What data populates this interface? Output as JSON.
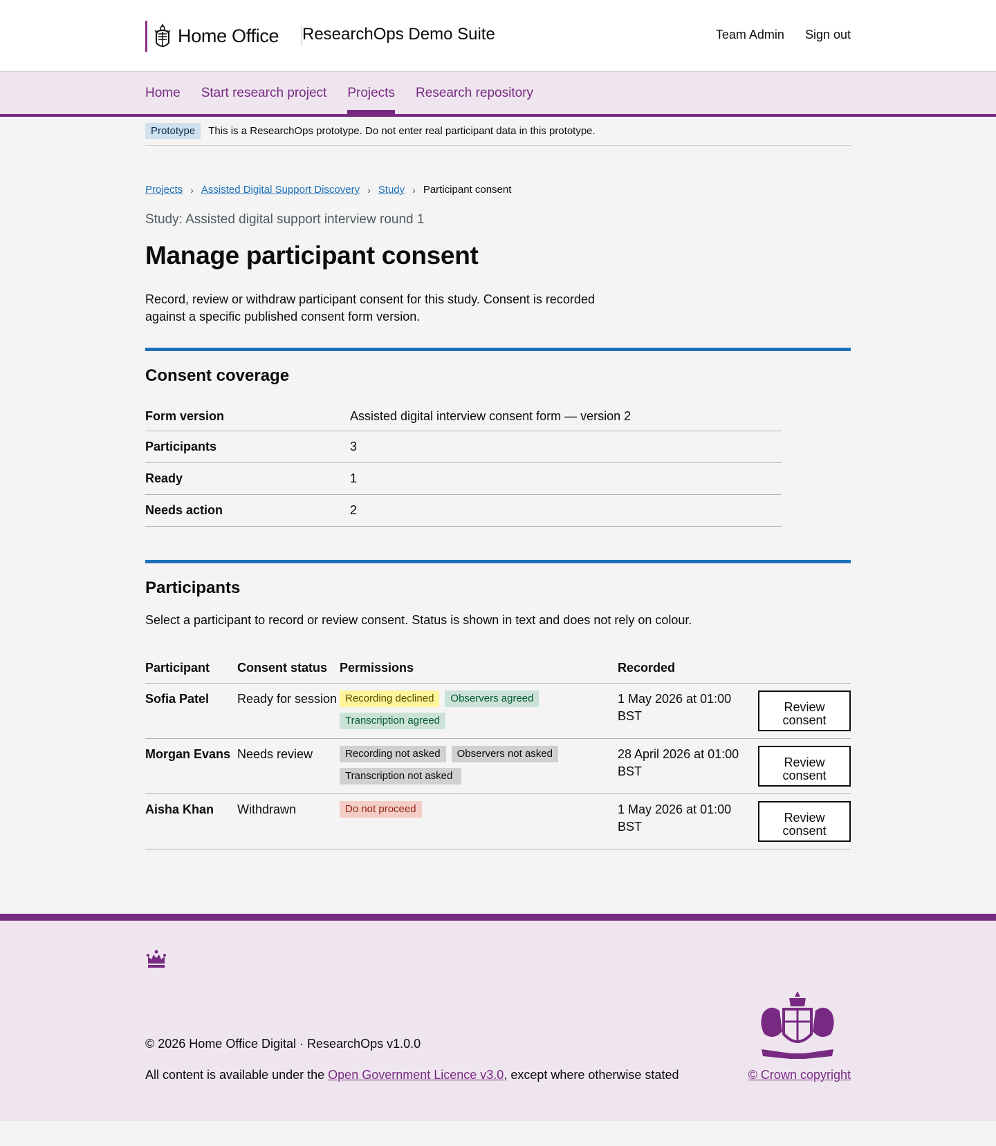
{
  "header": {
    "org_name": "Home Office",
    "service_name": "ResearchOps Demo Suite",
    "links": [
      "Team Admin",
      "Sign out"
    ]
  },
  "nav": {
    "items": [
      "Home",
      "Start research project",
      "Projects",
      "Research repository"
    ],
    "active": "Projects"
  },
  "phase": {
    "tag": "Prototype",
    "text": "This is a ResearchOps prototype. Do not enter real participant data in this prototype."
  },
  "breadcrumbs": {
    "links": [
      "Projects",
      "Assisted Digital Support Discovery",
      "Study"
    ],
    "current": "Participant consent"
  },
  "page": {
    "caption": "Study: Assisted digital support interview round 1",
    "title": "Manage participant consent",
    "lede": "Record, review or withdraw participant consent for this study. Consent is recorded against a specific published consent form version."
  },
  "coverage": {
    "heading": "Consent coverage",
    "rows": [
      {
        "key": "Form version",
        "value": "Assisted digital interview consent form — version 2"
      },
      {
        "key": "Participants",
        "value": "3"
      },
      {
        "key": "Ready",
        "value": "1"
      },
      {
        "key": "Needs action",
        "value": "2"
      }
    ]
  },
  "participants": {
    "heading": "Participants",
    "hint": "Select a participant to record or review consent. Status is shown in text and does not rely on colour.",
    "columns": [
      "Participant",
      "Consent status",
      "Permissions",
      "Recorded",
      ""
    ],
    "rows": [
      {
        "name": "Sofia Patel",
        "status": "Ready for session",
        "tags": [
          {
            "label": "Recording declined",
            "color": "#fff59a"
          },
          {
            "label": "Observers agreed",
            "color": "#cce2d8"
          },
          {
            "label": "Transcription agreed",
            "color": "#cce2d8"
          }
        ],
        "recorded": "1 May 2026 at 01:00 BST",
        "action": "Review consent"
      },
      {
        "name": "Morgan Evans",
        "status": "Needs review",
        "tags": [
          {
            "label": "Recording not asked",
            "color": "#d0d0d0"
          },
          {
            "label": "Observers not asked",
            "color": "#d0d0d0"
          },
          {
            "label": "Transcription not asked",
            "color": "#d0d0d0"
          }
        ],
        "recorded": "28 April 2026 at 01:00 BST",
        "action": "Review consent"
      },
      {
        "name": "Aisha Khan",
        "status": "Withdrawn",
        "tags": [
          {
            "label": "Do not proceed",
            "color": "#f4cdc6"
          }
        ],
        "recorded": "1 May 2026 at 01:00 BST",
        "action": "Review consent"
      }
    ]
  },
  "footer": {
    "copyright": "© 2026 Home Office Digital · ResearchOps v1.0.0",
    "licence_prefix": "All content is available under the ",
    "licence_link": "Open Government Licence v3.0",
    "licence_suffix": ", except where otherwise stated",
    "crown_copyright": "© Crown copyright"
  },
  "colors": {
    "brand_purple": "#782a82",
    "link_blue": "#1d70b8",
    "section_rule": "#1d70b8"
  }
}
